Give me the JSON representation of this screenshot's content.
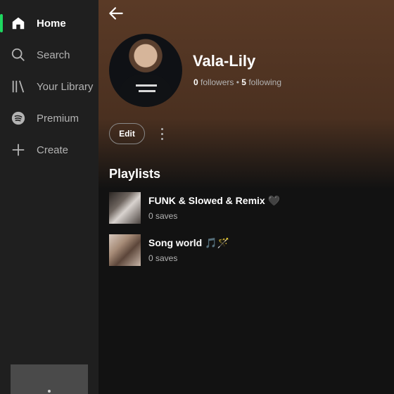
{
  "sidebar": {
    "items": [
      {
        "label": "Home",
        "icon": "home-icon"
      },
      {
        "label": "Search",
        "icon": "search-icon"
      },
      {
        "label": "Your Library",
        "icon": "library-icon"
      },
      {
        "label": "Premium",
        "icon": "spotify-icon"
      },
      {
        "label": "Create",
        "icon": "plus-icon"
      }
    ]
  },
  "profile": {
    "name": "Vala-Lily",
    "followers_count": "0",
    "followers_label": "followers",
    "separator": "•",
    "following_count": "5",
    "following_label": "following"
  },
  "actions": {
    "edit_label": "Edit"
  },
  "playlists": {
    "title": "Playlists",
    "items": [
      {
        "title": "FUNK & Slowed & Remix 🖤",
        "subtitle": "0 saves"
      },
      {
        "title": "Song world 🎵🪄",
        "subtitle": "0 saves"
      }
    ]
  },
  "colors": {
    "accent": "#1ed760",
    "sidebar_bg": "#1f1f1f",
    "main_bg": "#121212"
  }
}
